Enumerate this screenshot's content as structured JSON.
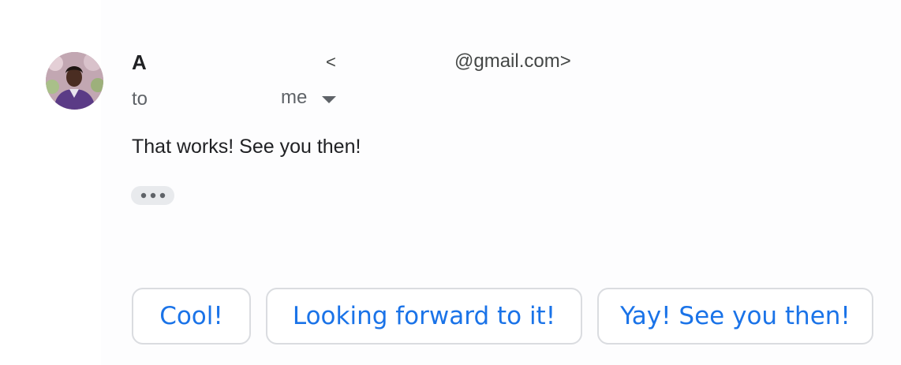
{
  "sender": {
    "name": "A",
    "email_open": "<",
    "email_domain": "@gmail.com>"
  },
  "recipients": {
    "prefix": "to",
    "me_label": "me"
  },
  "message": {
    "body": "That works! See you then!"
  },
  "smart_replies": [
    {
      "label": "Cool!"
    },
    {
      "label": "Looking forward to it!"
    },
    {
      "label": "Yay! See you then!"
    }
  ],
  "icons": {
    "avatar": "profile-photo",
    "dropdown": "caret-down-icon",
    "trim": "ellipsis-icon"
  },
  "colors": {
    "accent": "#1a73e8",
    "button_border": "#dadce0",
    "muted_text": "#5f6368",
    "trim_bg": "#e8eaed"
  }
}
